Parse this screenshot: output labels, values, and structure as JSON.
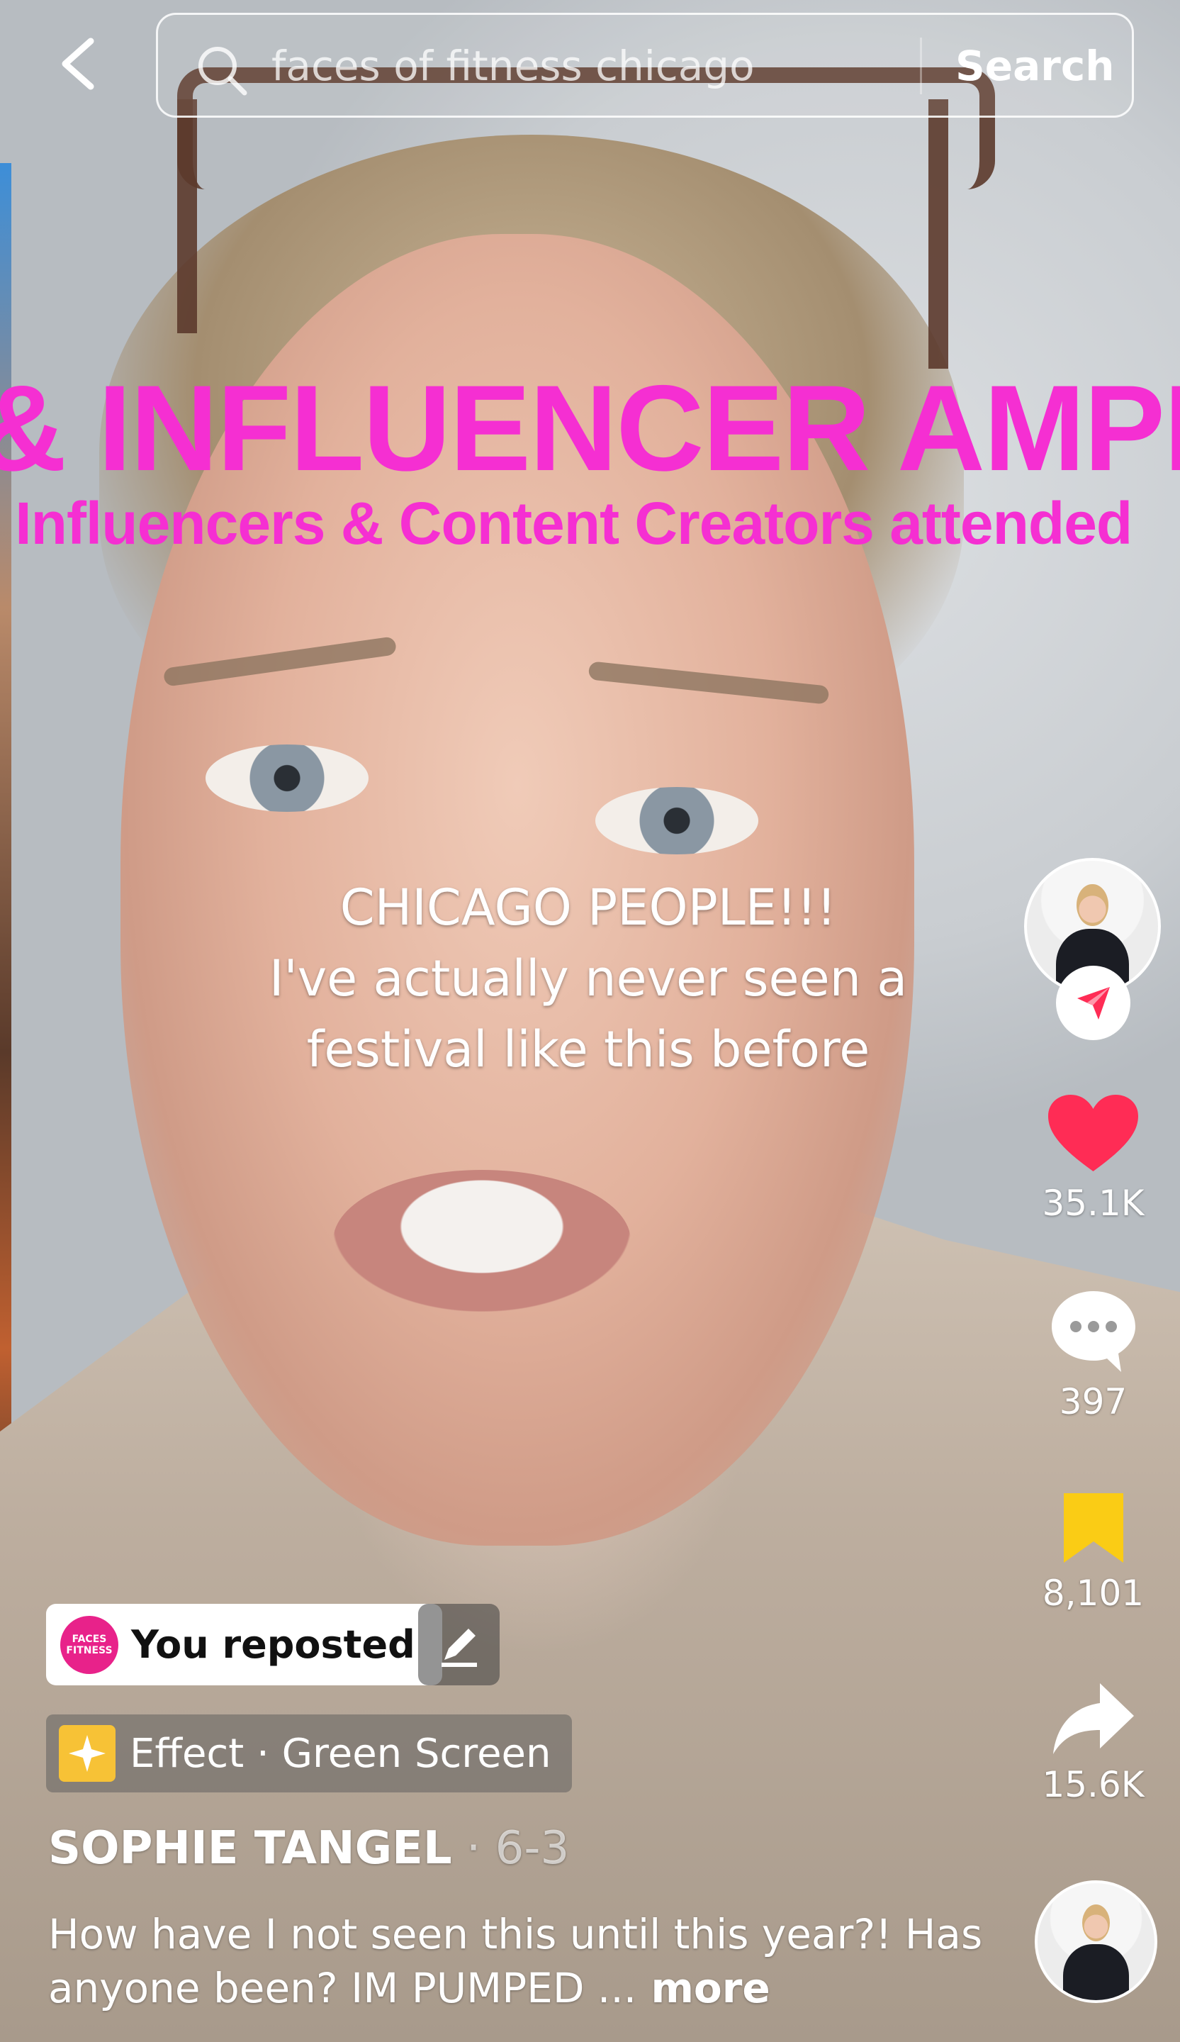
{
  "search": {
    "query": "faces of fitness chicago",
    "button_label": "Search"
  },
  "overlay": {
    "title": "& INFLUENCER AMPLIF",
    "subtitle": ": Influencers & Content Creators attended"
  },
  "video": {
    "caption_lines": [
      "CHICAGO PEOPLE!!!",
      "I've actually never seen a",
      "festival like this before"
    ]
  },
  "actions": {
    "likes": "35.1K",
    "comments": "397",
    "saves": "8,101",
    "shares": "15.6K"
  },
  "repost": {
    "brand_logo_text": "FACES FITNESS",
    "label": "You reposted"
  },
  "effect": {
    "label": "Effect · Green Screen"
  },
  "post": {
    "author": "SOPHIE TANGEL",
    "date": " · 6-3",
    "description": "How have I not seen this until this year?! Has anyone been? IM PUMPED ...",
    "more_label": " more"
  },
  "colors": {
    "overlay_magenta": "#f52fd2",
    "like_red": "#ff2c55",
    "save_yellow": "#facc15",
    "brand_pink": "#e8228a",
    "effect_yellow": "#f7c236"
  },
  "icons": [
    "back-chevron-icon",
    "search-icon",
    "repost-arrow-icon",
    "heart-icon",
    "comment-icon",
    "bookmark-icon",
    "share-arrow-icon",
    "pencil-icon",
    "sparkle-icon"
  ]
}
